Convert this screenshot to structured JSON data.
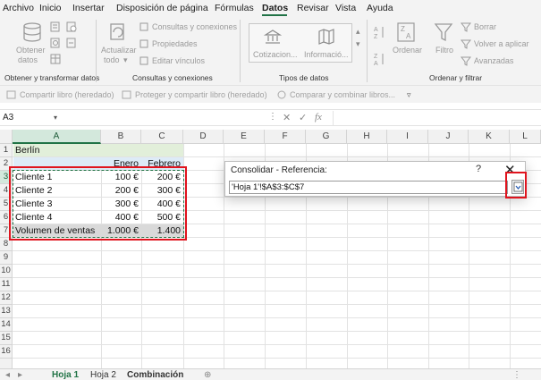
{
  "menu": {
    "tabs": [
      "Archivo",
      "Inicio",
      "Insertar",
      "Disposición de página",
      "Fórmulas",
      "Datos",
      "Revisar",
      "Vista",
      "Ayuda"
    ],
    "active": "Datos"
  },
  "ribbon": {
    "get_data": {
      "obtener_datos": "Obtener",
      "obtener_datos2": "datos",
      "group_label": "Obtener y transformar datos"
    },
    "queries": {
      "actualizar": "Actualizar",
      "actualizar2": "todo",
      "consultas": "Consultas y conexiones",
      "propiedades": "Propiedades",
      "editar_vinculos": "Editar vínculos",
      "group_label": "Consultas y conexiones"
    },
    "data_types": {
      "cotizacion": "Cotizacion...",
      "informacion": "Informació...",
      "group_label": "Tipos de datos"
    },
    "sort_filter": {
      "ordenar": "Ordenar",
      "filtro": "Filtro",
      "borrar": "Borrar",
      "volver_aplicar": "Volver a aplicar",
      "avanzadas": "Avanzadas",
      "group_label": "Ordenar y filtrar"
    },
    "row2": {
      "compartir": "Compartir libro (heredado)",
      "proteger": "Proteger y compartir libro (heredado)",
      "comparar": "Comparar y combinar libros..."
    }
  },
  "formula_bar": {
    "name_box": "A3",
    "fx": "fx",
    "value": ""
  },
  "grid": {
    "columns": [
      "A",
      "B",
      "C",
      "D",
      "E",
      "F",
      "G",
      "H",
      "I",
      "J",
      "K",
      "L"
    ],
    "rows": [
      "1",
      "2",
      "3",
      "4",
      "5",
      "6",
      "7",
      "8",
      "9",
      "10",
      "11",
      "12",
      "13",
      "14",
      "15",
      "16"
    ],
    "cells": {
      "A1": "Berlín",
      "B2": "Enero",
      "C2": "Febrero",
      "A3": "Cliente 1",
      "B3": "100 €",
      "C3": "200 €",
      "A4": "Cliente 2",
      "B4": "200 €",
      "C4": "300 €",
      "A5": "Cliente 3",
      "B5": "300 €",
      "C5": "400 €",
      "A6": "Cliente 4",
      "B6": "400 €",
      "C6": "500 €",
      "A7": "Volumen de ventas",
      "B7": "1.000 €",
      "C7": "1.400"
    }
  },
  "sheets": {
    "tabs": [
      "Hoja 1",
      "Hoja 2",
      "Combinación"
    ],
    "active": "Hoja 1"
  },
  "dialog": {
    "title": "Consolidar - Referencia:",
    "help": "?",
    "close": "✕",
    "reference": "'Hoja 1'!$A$3:$C$7"
  },
  "colors": {
    "accent": "#217346",
    "highlight_box": "#e0141e",
    "berlin_fill": "#e2efda",
    "header_fill": "#ddebf7",
    "total_fill": "#d9d9d9"
  }
}
